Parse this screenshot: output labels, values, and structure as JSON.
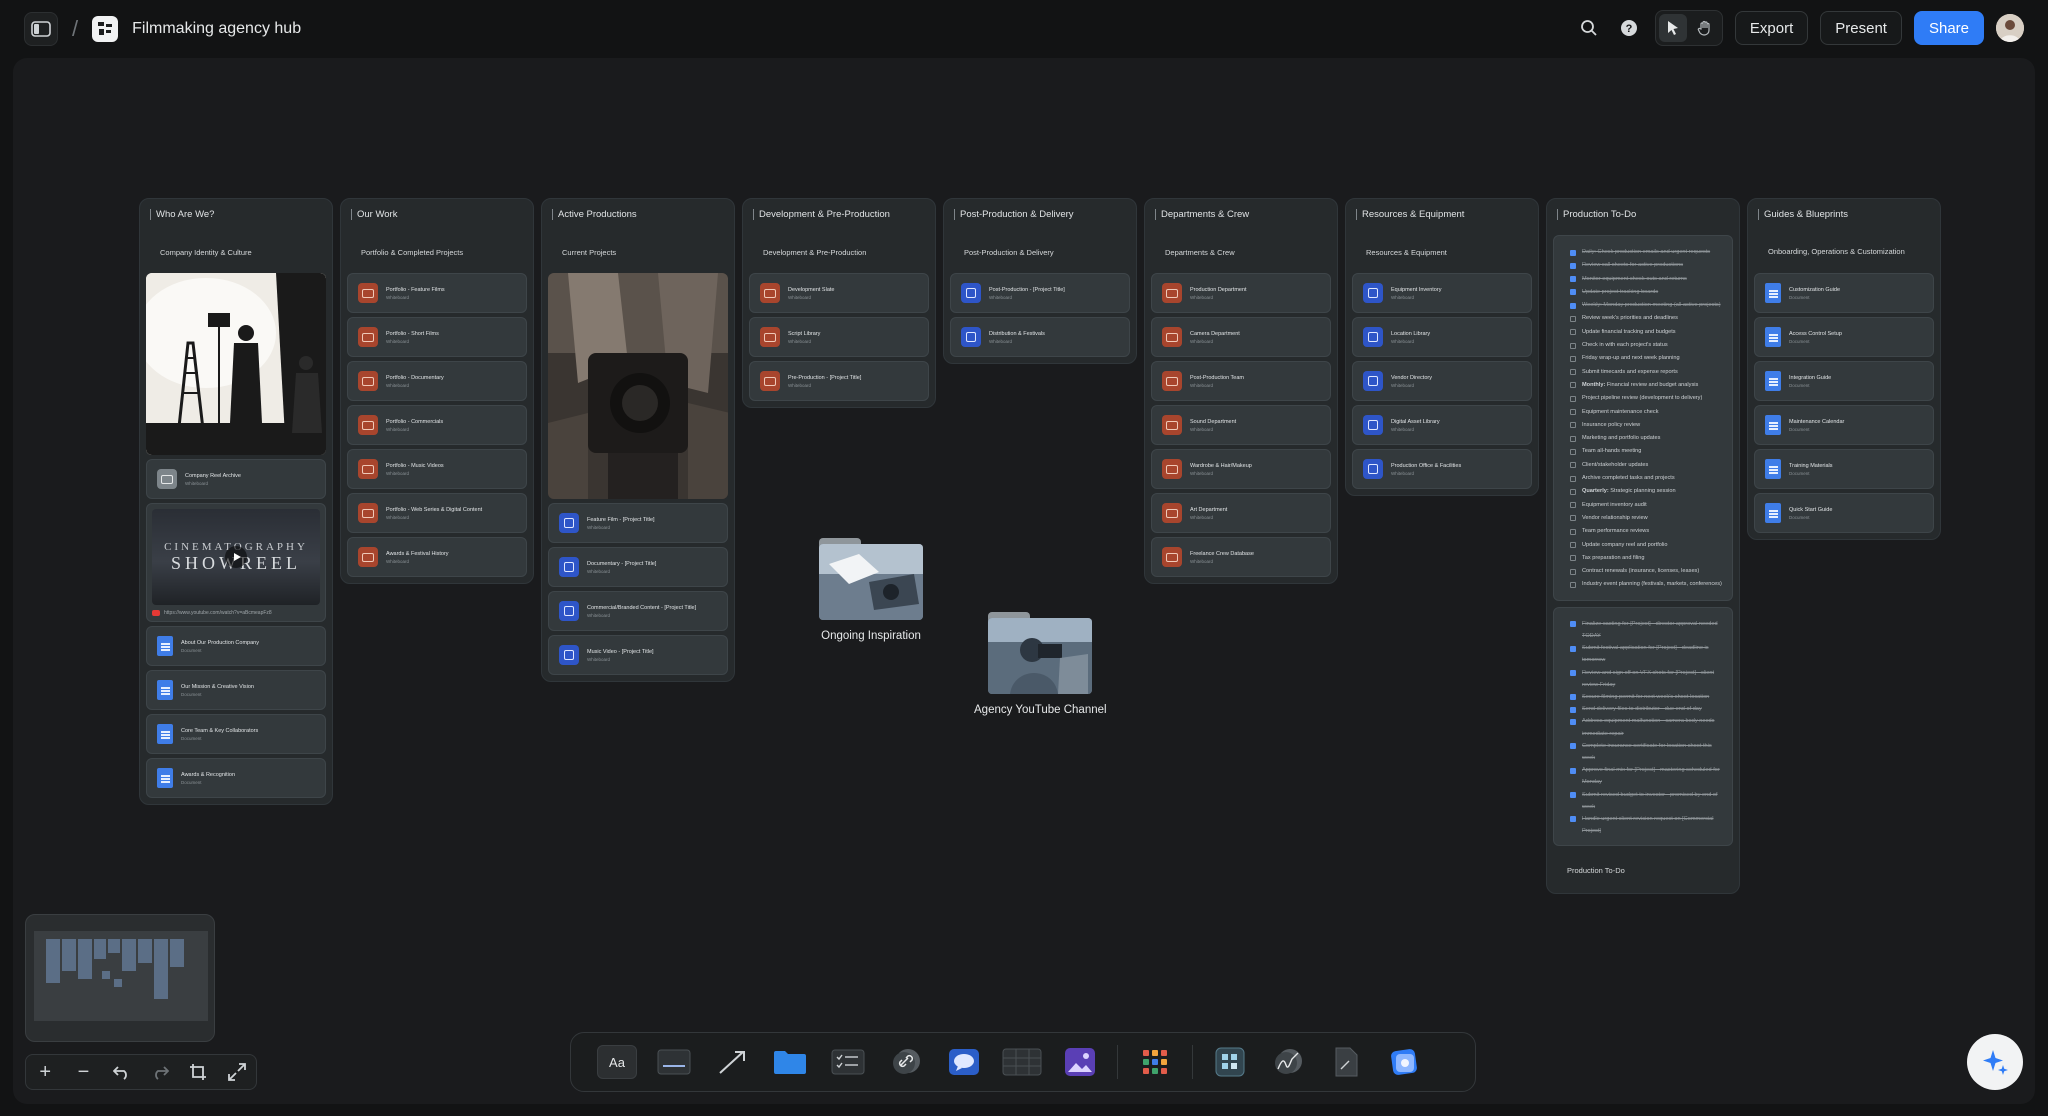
{
  "header": {
    "title": "Filmmaking agency hub",
    "export_label": "Export",
    "present_label": "Present",
    "share_label": "Share"
  },
  "columns": {
    "c1": {
      "title": "Who Are We?",
      "subtitle": "Company Identity & Culture",
      "items": [
        {
          "title": "Company Reel Archive",
          "type": "Whiteboard"
        },
        {
          "title": "About Our Production Company",
          "type": "Document"
        },
        {
          "title": "Our Mission & Creative Vision",
          "type": "Document"
        },
        {
          "title": "Core Team & Key Collaborators",
          "type": "Document"
        },
        {
          "title": "Awards & Recognition",
          "type": "Document"
        }
      ],
      "video": {
        "line1": "CINEMATOGRAPHY",
        "line2": "SHOWREEL",
        "url": "https://www.youtube.com/watch?v=aBcmeapFz8"
      }
    },
    "c2": {
      "title": "Our Work",
      "subtitle": "Portfolio & Completed Projects",
      "items": [
        {
          "title": "Portfolio - Feature Films",
          "type": "Whiteboard"
        },
        {
          "title": "Portfolio - Short Films",
          "type": "Whiteboard"
        },
        {
          "title": "Portfolio - Documentary",
          "type": "Whiteboard"
        },
        {
          "title": "Portfolio - Commercials",
          "type": "Whiteboard"
        },
        {
          "title": "Portfolio - Music Videos",
          "type": "Whiteboard"
        },
        {
          "title": "Portfolio - Web Series & Digital Content",
          "type": "Whiteboard"
        },
        {
          "title": "Awards & Festival History",
          "type": "Whiteboard"
        }
      ]
    },
    "c3": {
      "title": "Active Productions",
      "subtitle": "Current Projects",
      "items": [
        {
          "title": "Feature Film - [Project Title]",
          "type": "Whiteboard"
        },
        {
          "title": "Documentary - [Project Title]",
          "type": "Whiteboard"
        },
        {
          "title": "Commercial/Branded Content - [Project Title]",
          "type": "Whiteboard"
        },
        {
          "title": "Music Video - [Project Title]",
          "type": "Whiteboard"
        }
      ]
    },
    "c4": {
      "title": "Development & Pre-Production",
      "subtitle": "Development & Pre-Production",
      "items": [
        {
          "title": "Development Slate",
          "type": "Whiteboard"
        },
        {
          "title": "Script Library",
          "type": "Whiteboard"
        },
        {
          "title": "Pre-Production - [Project Title]",
          "type": "Whiteboard"
        }
      ]
    },
    "c5": {
      "title": "Post-Production & Delivery",
      "subtitle": "Post-Production & Delivery",
      "items": [
        {
          "title": "Post-Production - [Project Title]",
          "type": "Whiteboard"
        },
        {
          "title": "Distribution & Festivals",
          "type": "Whiteboard"
        }
      ]
    },
    "c6": {
      "title": "Departments & Crew",
      "subtitle": "Departments & Crew",
      "items": [
        {
          "title": "Production Department",
          "type": "Whiteboard"
        },
        {
          "title": "Camera Department",
          "type": "Whiteboard"
        },
        {
          "title": "Post-Production Team",
          "type": "Whiteboard"
        },
        {
          "title": "Sound Department",
          "type": "Whiteboard"
        },
        {
          "title": "Wardrobe & Hair/Makeup",
          "type": "Whiteboard"
        },
        {
          "title": "Art Department",
          "type": "Whiteboard"
        },
        {
          "title": "Freelance Crew Database",
          "type": "Whiteboard"
        }
      ]
    },
    "c7": {
      "title": "Resources & Equipment",
      "subtitle": "Resources & Equipment",
      "items": [
        {
          "title": "Equipment Inventory",
          "type": "Whiteboard"
        },
        {
          "title": "Location Library",
          "type": "Whiteboard"
        },
        {
          "title": "Vendor Directory",
          "type": "Whiteboard"
        },
        {
          "title": "Digital Asset Library",
          "type": "Whiteboard"
        },
        {
          "title": "Production Office & Facilities",
          "type": "Whiteboard"
        }
      ]
    },
    "c8": {
      "title": "Production To-Do",
      "footer": "Production To-Do",
      "todo1": [
        {
          "text": "Daily: Check production emails and urgent requests",
          "done": true
        },
        {
          "text": "Review call sheets for active productions",
          "done": true
        },
        {
          "text": "Monitor equipment check-outs and returns",
          "done": true
        },
        {
          "text": "Update project tracking boards",
          "done": true
        },
        {
          "text": "Weekly: Monday production meeting (all active projects)",
          "done": true
        },
        {
          "text": "Review week's priorities and deadlines",
          "done": false
        },
        {
          "text": "Update financial tracking and budgets",
          "done": false
        },
        {
          "text": "Check in with each project's status",
          "done": false
        },
        {
          "text": "Friday wrap-up and next week planning",
          "done": false
        },
        {
          "text": "Submit timecards and expense reports",
          "done": false
        },
        {
          "text": "Monthly: Financial review and budget analysis",
          "done": false,
          "bold": "Monthly:",
          "rest": " Financial review and budget analysis"
        },
        {
          "text": "Project pipeline review (development to delivery)",
          "done": false
        },
        {
          "text": "Equipment maintenance check",
          "done": false
        },
        {
          "text": "Insurance policy review",
          "done": false
        },
        {
          "text": "Marketing and portfolio updates",
          "done": false
        },
        {
          "text": "Team all-hands meeting",
          "done": false
        },
        {
          "text": "Client/stakeholder updates",
          "done": false
        },
        {
          "text": "Archive completed tasks and projects",
          "done": false
        },
        {
          "text": "Quarterly: Strategic planning session",
          "done": false,
          "bold": "Quarterly:",
          "rest": " Strategic planning session"
        },
        {
          "text": "Equipment inventory audit",
          "done": false
        },
        {
          "text": "Vendor relationship review",
          "done": false
        },
        {
          "text": "Team performance reviews",
          "done": false
        },
        {
          "text": "Update company reel and portfolio",
          "done": false
        },
        {
          "text": "Tax preparation and filing",
          "done": false
        },
        {
          "text": "Contract renewals (insurance, licenses, leases)",
          "done": false
        },
        {
          "text": "Industry event planning (festivals, markets, conferences)",
          "done": false
        }
      ],
      "todo2": [
        {
          "text": "Finalize casting for [Project] - director approval needed TODAY",
          "done": true
        },
        {
          "text": "Submit festival application for [Project] - deadline is tomorrow",
          "done": true
        },
        {
          "text": "Review and sign off on VFX shots for [Project] - client review Friday",
          "done": true
        },
        {
          "text": "Secure filming permit for next week's shoot location",
          "done": true
        },
        {
          "text": "Send delivery files to distributor - due end of day",
          "done": true
        },
        {
          "text": "Address equipment malfunction - camera body needs immediate repair",
          "done": true
        },
        {
          "text": "Complete insurance certificate for location shoot this week",
          "done": true
        },
        {
          "text": "Approve final mix for [Project] - mastering scheduled for Monday",
          "done": true
        },
        {
          "text": "Submit revised budget to investor - promised by end of week",
          "done": true
        },
        {
          "text": "Handle urgent client revision request on [Commercial Project]",
          "done": true
        }
      ]
    },
    "c9": {
      "title": "Guides & Blueprints",
      "subtitle": "Onboarding, Operations & Customization",
      "items": [
        {
          "title": "Customization Guide",
          "type": "Document"
        },
        {
          "title": "Access Control Setup",
          "type": "Document"
        },
        {
          "title": "Integration Guide",
          "type": "Document"
        },
        {
          "title": "Maintenance Calendar",
          "type": "Document"
        },
        {
          "title": "Training Materials",
          "type": "Document"
        },
        {
          "title": "Quick Start Guide",
          "type": "Document"
        }
      ]
    }
  },
  "folders": {
    "inspiration": "Ongoing Inspiration",
    "youtube": "Agency YouTube Channel"
  },
  "toolbar": {
    "text_tool_label": "Aa"
  },
  "colors": {
    "accent": "#2f7cf6",
    "whiteboard_icon": "#a8452d",
    "document_icon": "#3f7de8",
    "canvas": "#1a1b1d",
    "column": "#262a2c"
  }
}
